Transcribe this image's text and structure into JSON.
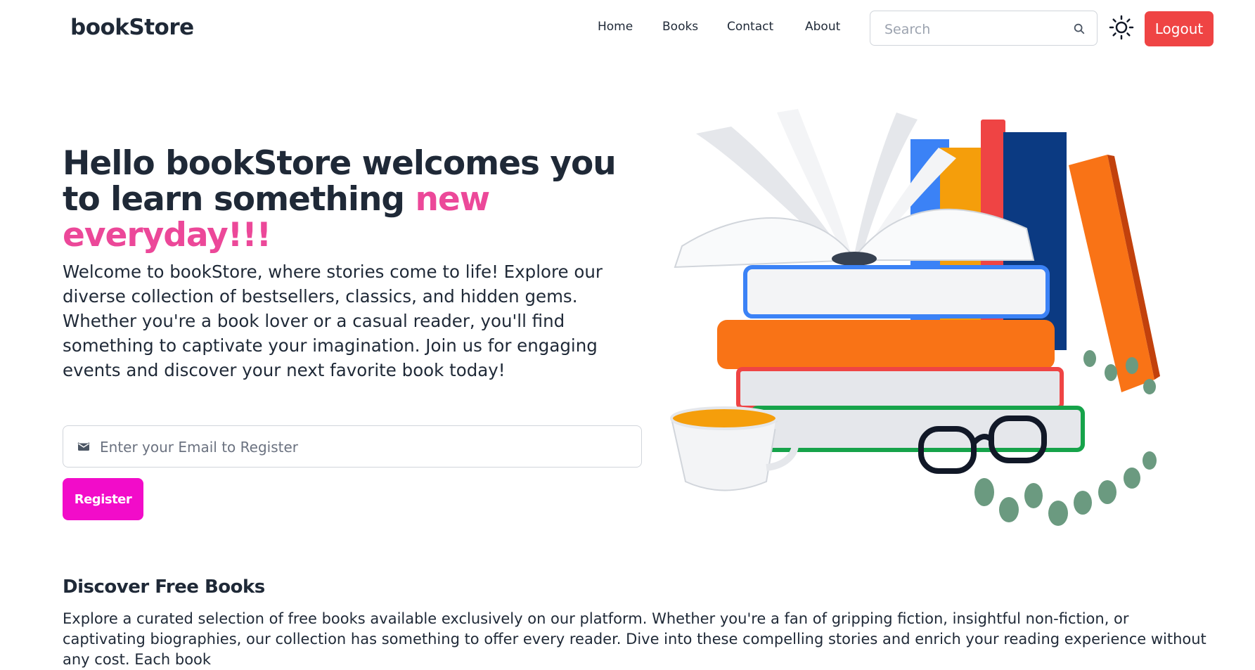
{
  "brand": {
    "name": "bookStore"
  },
  "nav": {
    "items": [
      "Home",
      "Books",
      "Contact",
      "About"
    ]
  },
  "search": {
    "placeholder": "Search",
    "icon": "search-icon"
  },
  "theme_toggle": {
    "icon": "sun-icon"
  },
  "logout": {
    "label": "Logout",
    "color": "#ef4444"
  },
  "hero": {
    "title_part1": "Hello bookStore welcomes you to learn something ",
    "title_accent": "new everyday!!!",
    "accent_color": "#ec4899",
    "description": "Welcome to bookStore, where stories come to life! Explore our diverse collection of bestsellers, classics, and hidden gems. Whether you're a book lover or a casual reader, you'll find something to captivate your imagination. Join us for engaging events and discover your next favorite book today!",
    "email_placeholder": "Enter your Email to Register",
    "email_icon": "envelope-icon",
    "register_label": "Register",
    "register_color": "#f20cc9"
  },
  "discover": {
    "title": "Discover Free Books",
    "text": "Explore a curated selection of free books available exclusively on our platform. Whether you're a fan of gripping fiction, insightful non-fiction, or captivating biographies, our collection has something to offer every reader. Dive into these compelling stories and enrich your reading experience without any cost. Each book"
  }
}
